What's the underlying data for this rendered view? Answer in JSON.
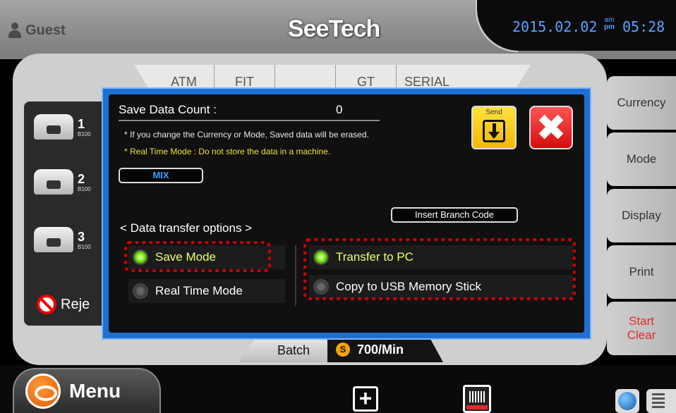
{
  "header": {
    "user": "Guest",
    "logo": "SeeTech",
    "date": "2015.02.02",
    "am": "am",
    "pm": "pm",
    "time": "05:28"
  },
  "tabs": [
    "ATM",
    "FIT",
    "",
    "GT",
    "SERIAL"
  ],
  "devices": [
    {
      "num": "1",
      "model": "B100"
    },
    {
      "num": "2",
      "model": "B100"
    },
    {
      "num": "3",
      "model": "B100"
    }
  ],
  "reject_label": "Reje",
  "side_buttons": {
    "currency": "Currency",
    "mode": "Mode",
    "display": "Display",
    "print": "Print",
    "start_clear": "Start\nClear"
  },
  "status": {
    "batch": "Batch",
    "speed_icon": "S",
    "speed": "700/Min"
  },
  "menu_label": "Menu",
  "dialog": {
    "title": "Save Data Count :",
    "count": "0",
    "note1": "* If you change the Currency or Mode, Saved data will be erased.",
    "note2": "* Real Time Mode : Do not store the data in a machine.",
    "mix_label": "MIX",
    "send_label": "Send",
    "close_symbol": "✖",
    "branch_button": "Insert Branch Code",
    "options_title": "< Data transfer options >",
    "save_mode": "Save Mode",
    "real_time_mode": "Real Time Mode",
    "transfer_pc": "Transfer to PC",
    "copy_usb": "Copy to USB Memory Stick"
  },
  "colors": {
    "accent_blue": "#1f6fd0",
    "clock_blue": "#5aa3ff",
    "highlight_red": "#d10000",
    "selected_text": "#f1ff6a",
    "warning_yellow": "#f3e030"
  }
}
